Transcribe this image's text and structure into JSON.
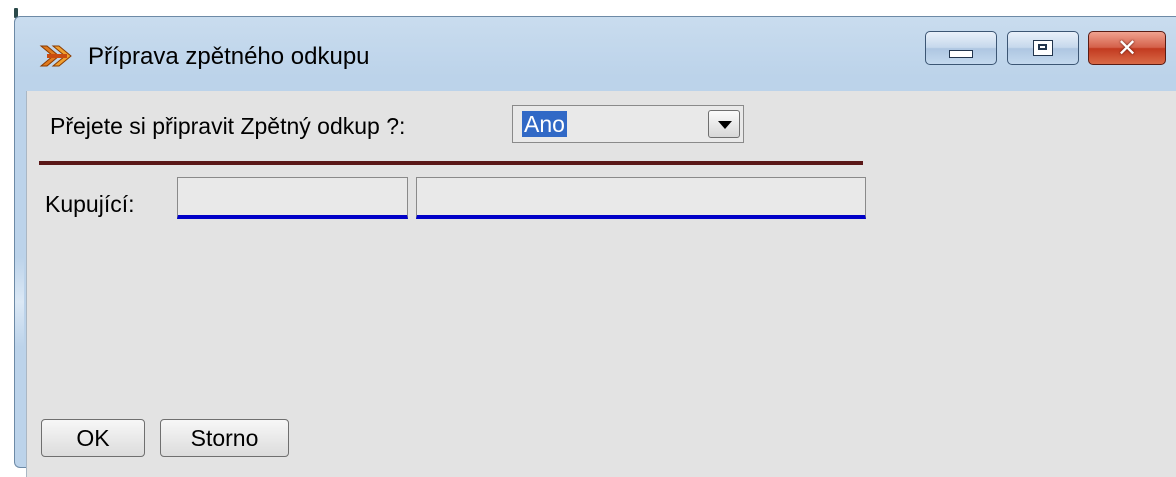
{
  "window": {
    "title": "Příprava zpětného odkupu",
    "caption_close_glyph": "✕"
  },
  "form": {
    "question_label": "Přejete si připravit Zpětný odkup ?:",
    "question_value": "Ano",
    "buyer_label": "Kupující:",
    "buyer_code_value": "",
    "buyer_name_value": ""
  },
  "buttons": {
    "ok_label": "OK",
    "cancel_label": "Storno"
  },
  "colors": {
    "separator": "#5a1717",
    "field_underline": "#0000c8",
    "selection": "#3169c6",
    "client_bg": "#e3e3e3"
  },
  "icons": {
    "app": "app-logo-icon",
    "minimize": "minimize-icon",
    "maximize": "maximize-icon",
    "close": "close-icon",
    "dropdown": "chevron-down-icon"
  }
}
